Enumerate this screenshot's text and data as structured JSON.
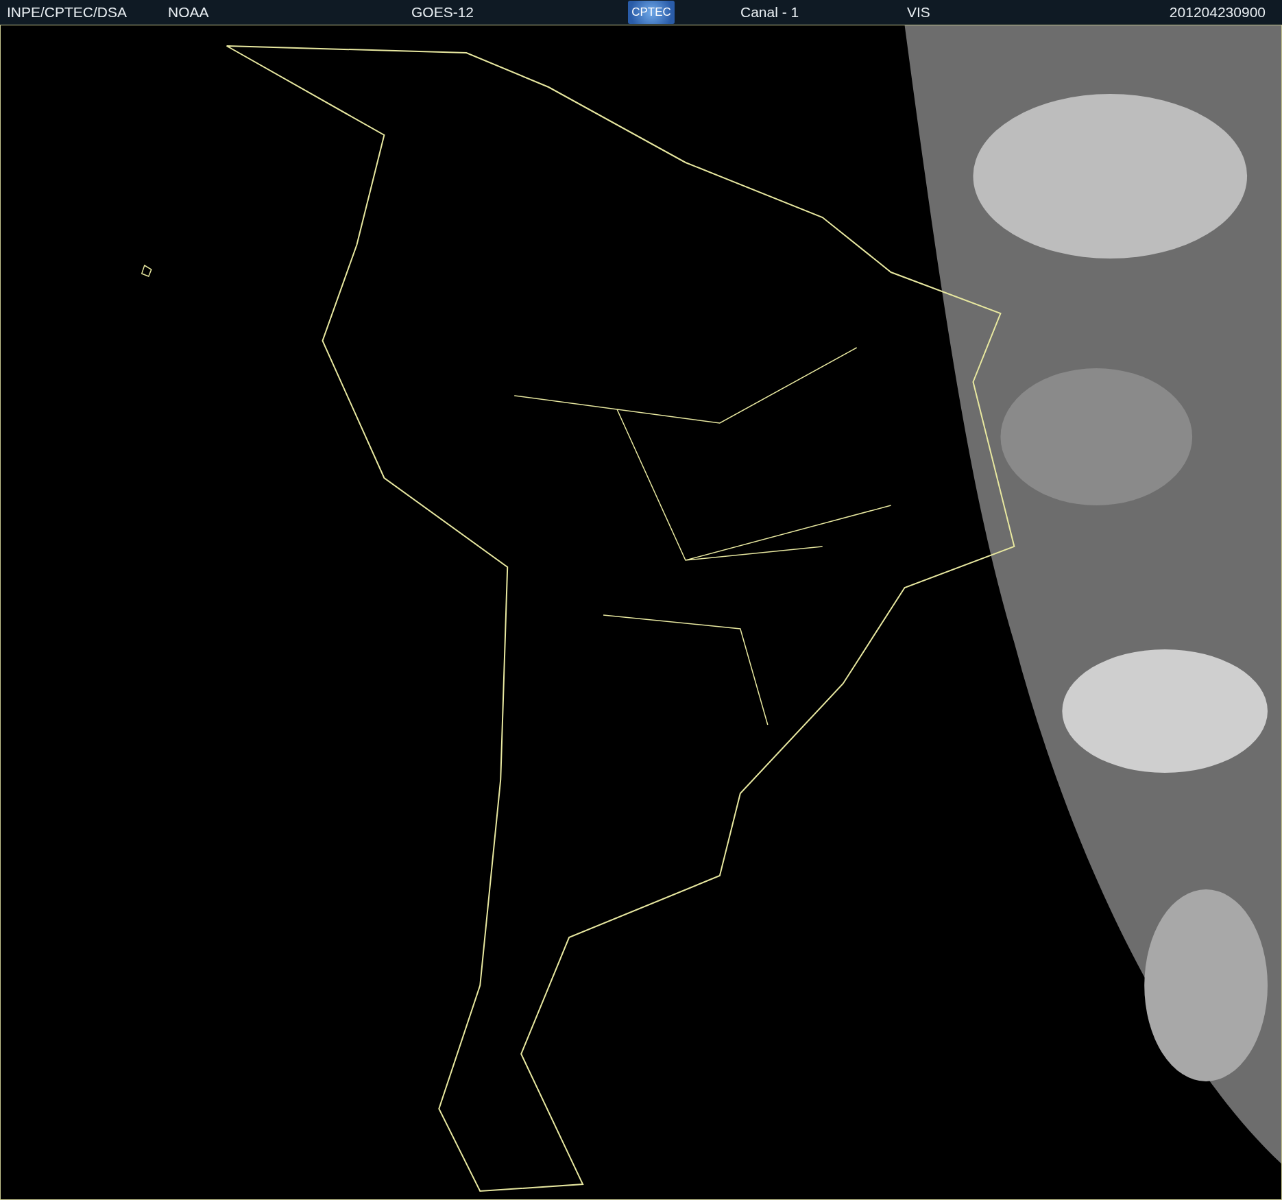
{
  "header": {
    "items": [
      {
        "kind": "text",
        "text": "INPE/CPTEC/DSA"
      },
      {
        "kind": "text",
        "text": "NOAA"
      },
      {
        "kind": "text",
        "text": "GOES-12"
      },
      {
        "kind": "logo",
        "text": "CPTEC"
      },
      {
        "kind": "text",
        "text": "Canal - 1"
      },
      {
        "kind": "text",
        "text": "VIS"
      },
      {
        "kind": "date",
        "text": "201204230900"
      }
    ]
  }
}
